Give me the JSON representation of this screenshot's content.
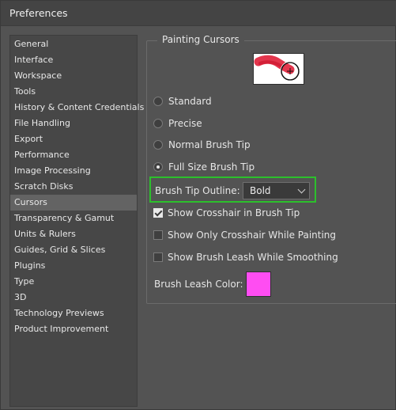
{
  "window": {
    "title": "Preferences"
  },
  "sidebar": {
    "items": [
      {
        "label": "General"
      },
      {
        "label": "Interface"
      },
      {
        "label": "Workspace"
      },
      {
        "label": "Tools"
      },
      {
        "label": "History & Content Credentials"
      },
      {
        "label": "File Handling"
      },
      {
        "label": "Export"
      },
      {
        "label": "Performance"
      },
      {
        "label": "Image Processing"
      },
      {
        "label": "Scratch Disks"
      },
      {
        "label": "Cursors"
      },
      {
        "label": "Transparency & Gamut"
      },
      {
        "label": "Units & Rulers"
      },
      {
        "label": "Guides, Grid & Slices"
      },
      {
        "label": "Plugins"
      },
      {
        "label": "Type"
      },
      {
        "label": "3D"
      },
      {
        "label": "Technology Previews"
      },
      {
        "label": "Product Improvement"
      }
    ],
    "selected": "Cursors"
  },
  "painting_cursors": {
    "group_title": "Painting Cursors",
    "preview_icon": "brush-cursor-preview-icon",
    "radios": [
      {
        "label": "Standard",
        "checked": false
      },
      {
        "label": "Precise",
        "checked": false
      },
      {
        "label": "Normal Brush Tip",
        "checked": false
      },
      {
        "label": "Full Size Brush Tip",
        "checked": true
      }
    ],
    "brush_tip_outline": {
      "label": "Brush Tip Outline:",
      "value": "Bold"
    },
    "checkboxes": [
      {
        "label": "Show Crosshair in Brush Tip",
        "checked": true
      },
      {
        "label": "Show Only Crosshair While Painting",
        "checked": false
      },
      {
        "label": "Show Brush Leash While Smoothing",
        "checked": false
      }
    ],
    "brush_leash_color": {
      "label": "Brush Leash Color:",
      "color": "#ff4df2"
    }
  },
  "colors": {
    "highlight": "#2cc02c",
    "stroke": "#e0203a"
  }
}
